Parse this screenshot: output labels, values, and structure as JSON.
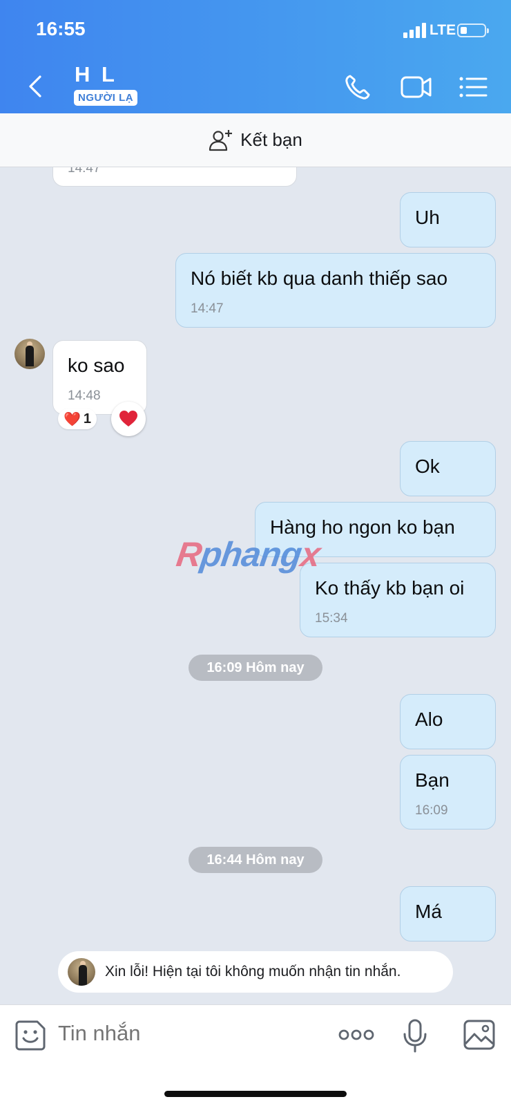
{
  "status": {
    "time": "16:55",
    "network": "LTE"
  },
  "header": {
    "name": "H L",
    "badge": "NGƯỜI LẠ"
  },
  "add_friend": {
    "label": "Kết bạn"
  },
  "messages": [
    {
      "dir": "in",
      "text": "",
      "time": "14:47"
    },
    {
      "dir": "out",
      "text": "Uh",
      "time": ""
    },
    {
      "dir": "out",
      "text": "Nó biết kb qua danh thiếp sao",
      "time": "14:47"
    },
    {
      "dir": "in",
      "text": "ko sao",
      "time": "14:48"
    },
    {
      "dir": "out",
      "text": "Ok",
      "time": ""
    },
    {
      "dir": "out",
      "text": "Hàng ho ngon ko bạn",
      "time": ""
    },
    {
      "dir": "out",
      "text": "Ko thấy kb bạn oi",
      "time": "15:34"
    },
    {
      "dir": "out",
      "text": "Alo",
      "time": ""
    },
    {
      "dir": "out",
      "text": "Bạn",
      "time": "16:09"
    },
    {
      "dir": "out",
      "text": "Má",
      "time": ""
    }
  ],
  "reaction": {
    "emoji": "❤️",
    "count": "1"
  },
  "dividers": [
    "16:09 Hôm nay",
    "16:44 Hôm nay"
  ],
  "watermark": {
    "part1": "R",
    "part2": "phang",
    "part3": "x"
  },
  "notice": {
    "text": "Xin lỗi! Hiện tại tôi không muốn nhận tin nhắn."
  },
  "input": {
    "placeholder": "Tin nhắn"
  },
  "colors": {
    "header_start": "#3f85ef",
    "header_end": "#4aa8ef",
    "outgoing_bubble": "#d5ecfb",
    "incoming_bubble": "#ffffff",
    "badge_text": "#3f7fd7"
  }
}
